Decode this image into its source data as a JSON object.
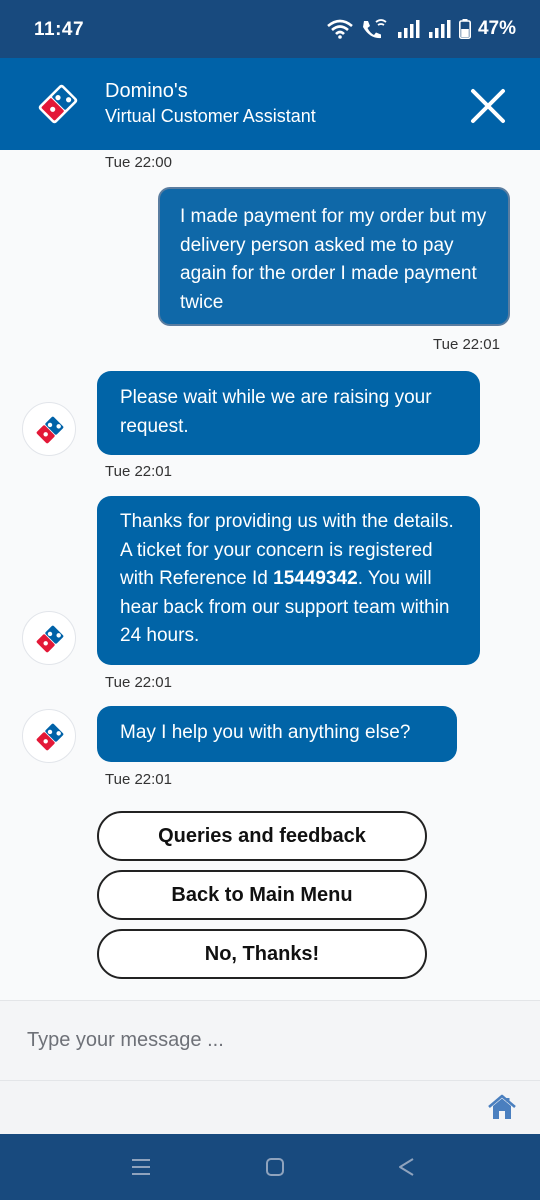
{
  "status_bar": {
    "time": "11:47",
    "battery": "47%",
    "icons": [
      "wifi-icon",
      "wifi-calling-icon",
      "signal-icon",
      "signal-icon",
      "battery-icon"
    ]
  },
  "header": {
    "title": "Domino's",
    "subtitle": "Virtual Customer Assistant",
    "close_icon": "close-icon"
  },
  "colors": {
    "brand_blue": "#0062a8",
    "status_bar": "#184a7e",
    "domino_red": "#e31837"
  },
  "messages": [
    {
      "sender": "user",
      "text": "I made payment for my order but my delivery person asked me to pay again for the order I made payment twice",
      "time": "Tue 22:01",
      "time_above": "Tue 22:00"
    },
    {
      "sender": "bot",
      "text": "Please wait while we are raising your request.",
      "time": "Tue 22:01"
    },
    {
      "sender": "bot",
      "text_before": "Thanks for providing us with the details. A ticket for your concern is registered with Reference Id ",
      "reference_id": "15449342",
      "text_after": ". You will hear back from our support team within 24 hours.",
      "time": "Tue 22:01"
    },
    {
      "sender": "bot",
      "text": "May I help you with anything else?",
      "time": "Tue 22:01"
    }
  ],
  "quick_replies": [
    "Queries and feedback",
    "Back to Main Menu",
    "No, Thanks!"
  ],
  "composer": {
    "placeholder": "Type your message ...",
    "home_icon": "home-icon"
  },
  "nav_bar": {
    "icons": [
      "recent-apps-icon",
      "home-nav-icon",
      "back-icon"
    ]
  }
}
